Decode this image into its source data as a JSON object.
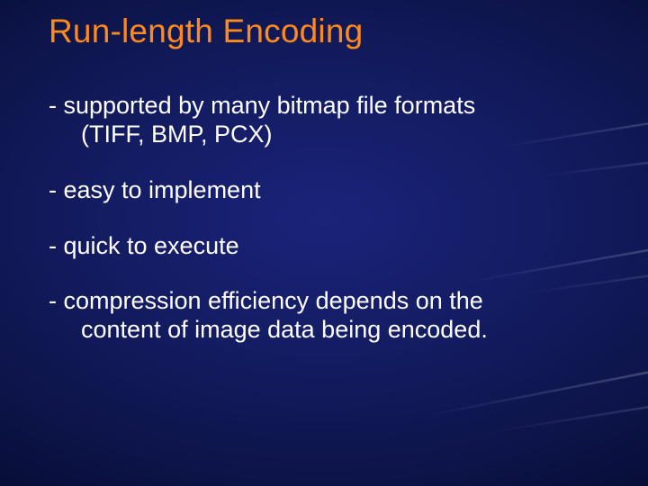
{
  "title": "Run-length Encoding",
  "bullets": [
    {
      "line1": "-  supported by many bitmap file formats",
      "line2": "(TIFF, BMP, PCX)"
    },
    {
      "line1": "- easy to implement",
      "line2": ""
    },
    {
      "line1": "- quick to execute",
      "line2": ""
    },
    {
      "line1": "- compression efficiency depends on the",
      "line2": "content of image data being encoded."
    }
  ]
}
